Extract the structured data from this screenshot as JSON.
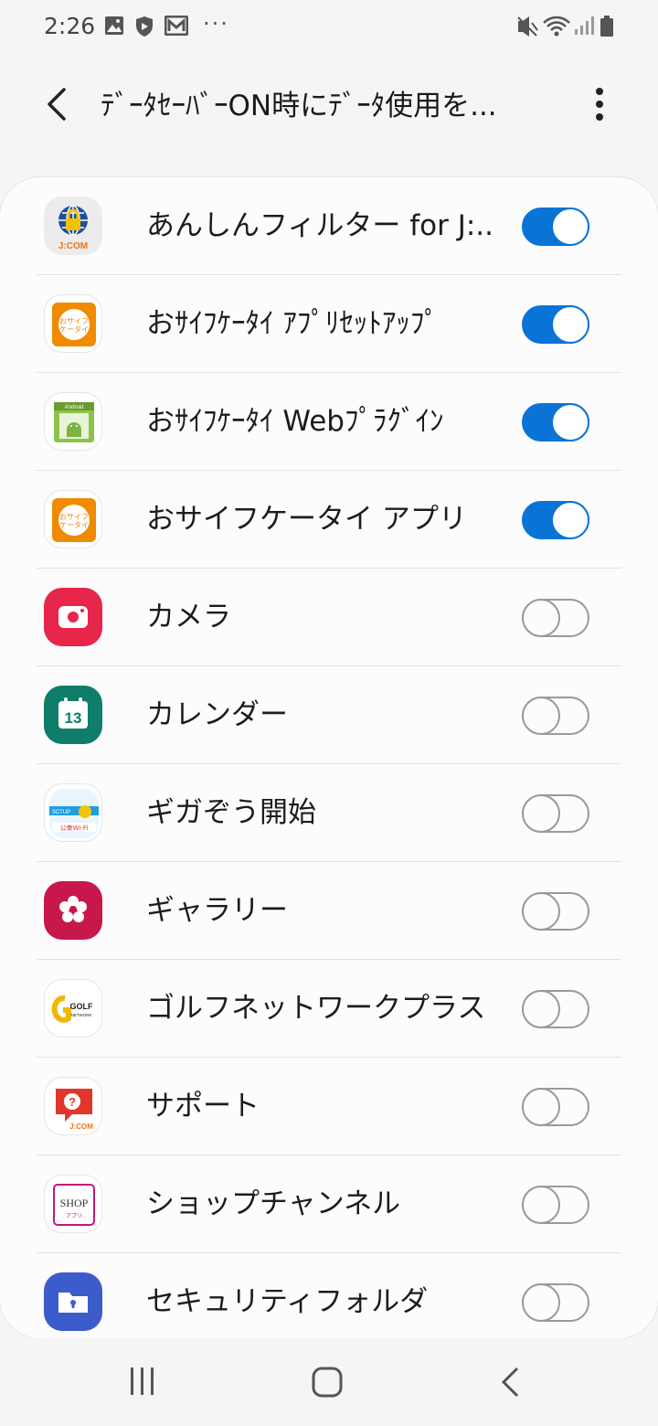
{
  "status_bar": {
    "time": "2:26",
    "dots": "···",
    "icons": [
      "image-icon",
      "shield-icon",
      "mail-icon",
      "mute-icon",
      "wifi-icon",
      "signal-icon",
      "battery-icon"
    ]
  },
  "app_bar": {
    "title": "ﾃﾞｰﾀｾｰﾊﾞｰON時にﾃﾞｰﾀ使用を...",
    "back_icon": "back-arrow-icon",
    "more_icon": "more-vert-icon"
  },
  "colors": {
    "accent": "#0a74d6",
    "toggle_off": "#9a9a9a"
  },
  "apps": [
    {
      "label": "あんしんフィルター for J:...",
      "enabled": true,
      "icon": "jcom-filter-icon"
    },
    {
      "label": "おｻｲﾌｹｰﾀｲ ｱﾌﾟﾘｾｯﾄｱｯﾌﾟ",
      "enabled": true,
      "icon": "osaifu-icon"
    },
    {
      "label": "おｻｲﾌｹｰﾀｲ Webﾌﾟﾗｸﾞｲﾝ",
      "enabled": true,
      "icon": "android-plugin-icon"
    },
    {
      "label": "おサイフケータイ アプリ",
      "enabled": true,
      "icon": "osaifu-icon"
    },
    {
      "label": "カメラ",
      "enabled": false,
      "icon": "camera-icon"
    },
    {
      "label": "カレンダー",
      "enabled": false,
      "icon": "calendar-icon"
    },
    {
      "label": "ギガぞう開始",
      "enabled": false,
      "icon": "gigazo-icon"
    },
    {
      "label": "ギャラリー",
      "enabled": false,
      "icon": "gallery-icon"
    },
    {
      "label": "ゴルフネットワークプラス",
      "enabled": false,
      "icon": "golf-network-icon"
    },
    {
      "label": "サポート",
      "enabled": false,
      "icon": "jcom-support-icon"
    },
    {
      "label": "ショップチャンネル",
      "enabled": false,
      "icon": "shop-channel-icon"
    },
    {
      "label": "セキュリティフォルダ",
      "enabled": false,
      "icon": "secure-folder-icon"
    }
  ],
  "icon_text": {
    "jcom": "J:COM",
    "osaifu": "おサイフ ケータイ",
    "android": "Android",
    "calendar_day": "13",
    "gigazo_top": "SCTUP",
    "gigazo_bottom": "公衆Wi-Fi",
    "golf": "GOLF",
    "golf_sub": "NETWORK",
    "shop": "SHOP",
    "shop_sub": "アプリ"
  },
  "nav": [
    "recents-icon",
    "home-icon",
    "back-icon"
  ]
}
